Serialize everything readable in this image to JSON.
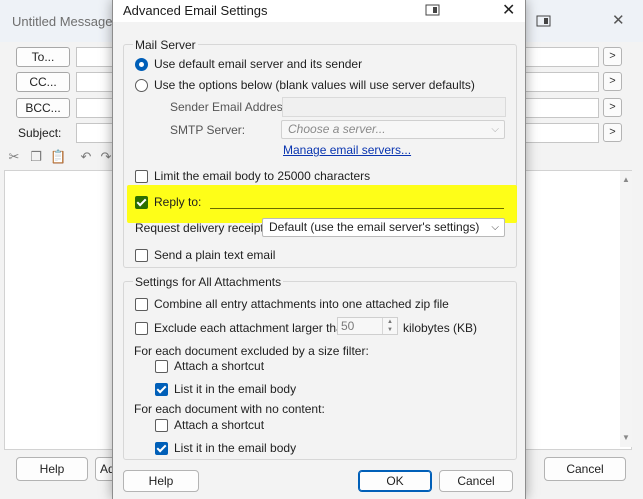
{
  "background_window": {
    "title": "Untitled Message",
    "to_label": "To...",
    "cc_label": "CC...",
    "bcc_label": "BCC...",
    "subject_label": "Subject:",
    "help_label": "Help",
    "add_label_partial": "Ad",
    "cancel_label": "Cancel",
    "arrow_glyph": ">"
  },
  "dialog": {
    "title": "Advanced Email Settings",
    "close_glyph": "✕",
    "mail_server": {
      "group_title": "Mail Server",
      "option_default": "Use default email server and its sender",
      "option_custom": "Use the options below (blank values will use server defaults)",
      "selected": "default",
      "sender_label": "Sender Email Address:",
      "sender_value": "",
      "smtp_label": "SMTP Server:",
      "smtp_placeholder": "Choose a server...",
      "manage_link": "Manage email servers...",
      "limit_body_label": "Limit the email body to 25000 characters",
      "limit_body_checked": false,
      "reply_to_label": "Reply to:",
      "reply_to_checked": true,
      "reply_to_value": "",
      "delivery_label": "Request delivery receipt:",
      "delivery_value": "Default (use the email server's settings)",
      "plain_text_label": "Send a plain text email",
      "plain_text_checked": false
    },
    "attachments": {
      "group_title": "Settings for All Attachments",
      "combine_label": "Combine all entry attachments into one attached zip file",
      "combine_checked": false,
      "exclude_label": "Exclude each attachment larger than",
      "exclude_checked": false,
      "exclude_size": "50",
      "exclude_unit": "kilobytes (KB)",
      "size_filter_heading": "For each document excluded by a size filter:",
      "size_attach_shortcut": "Attach a shortcut",
      "size_attach_shortcut_checked": false,
      "size_list_body": "List it in the email body",
      "size_list_body_checked": true,
      "no_content_heading": "For each document with no content:",
      "nc_attach_shortcut": "Attach a shortcut",
      "nc_attach_shortcut_checked": false,
      "nc_list_body": "List it in the email body",
      "nc_list_body_checked": true
    },
    "buttons": {
      "help": "Help",
      "ok": "OK",
      "cancel": "Cancel"
    }
  },
  "colors": {
    "accent": "#005fb8",
    "highlight": "#ffff00",
    "link": "#0a35b0"
  }
}
